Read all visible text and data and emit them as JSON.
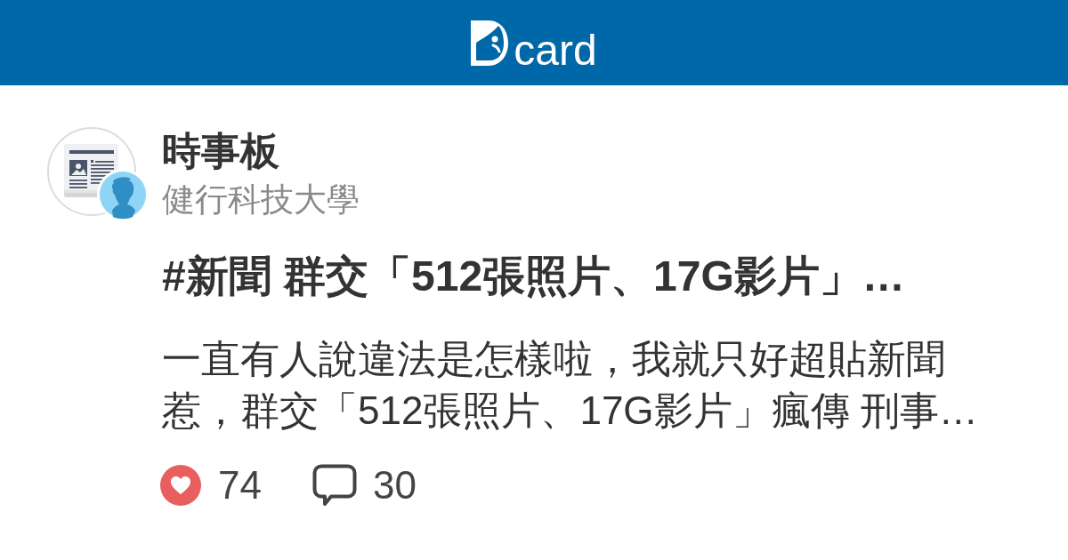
{
  "header": {
    "logo_text": "card"
  },
  "board": {
    "name": "時事板",
    "school": "健行科技大學"
  },
  "post": {
    "title": "#新聞 群交「512張照片、17G影片」…",
    "excerpt": "一直有人說違法是怎樣啦，我就只好超貼新聞惹，群交「512張照片、17G影片」瘋傳 刑事…",
    "likes": "74",
    "comments": "30"
  }
}
